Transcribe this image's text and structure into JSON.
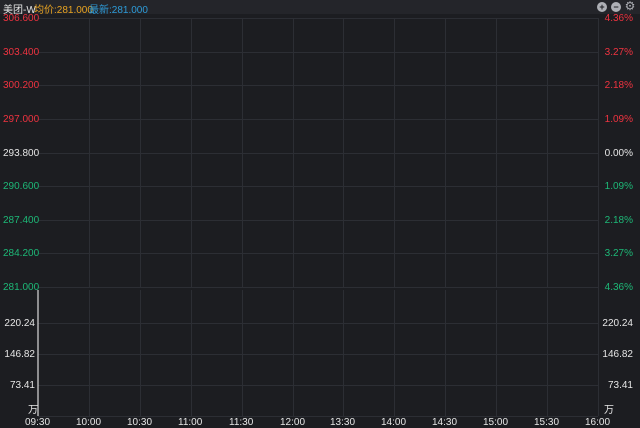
{
  "header": {
    "stock_name": "美团-W",
    "avg_price": "均价:281.000",
    "last_price": "最新:281.000"
  },
  "toolbar": {
    "icons": [
      "plus-circle-icon",
      "minus-circle-icon",
      "gear-icon"
    ]
  },
  "price_axis": {
    "prices": [
      "306.600",
      "303.400",
      "300.200",
      "297.000",
      "293.800",
      "290.600",
      "287.400",
      "284.200",
      "281.000"
    ],
    "percents": [
      "4.36%",
      "3.27%",
      "2.18%",
      "1.09%",
      "0.00%",
      "1.09%",
      "2.18%",
      "3.27%",
      "4.36%"
    ]
  },
  "volume_axis": {
    "values": [
      "220.24",
      "146.82",
      "73.41"
    ],
    "unit": "万"
  },
  "time_axis": [
    "09:30",
    "10:00",
    "10:30",
    "11:00",
    "11:30",
    "12:00",
    "13:30",
    "14:00",
    "14:30",
    "15:00",
    "15:30",
    "16:00"
  ],
  "colors": {
    "up": "#ef3340",
    "down": "#1db877",
    "flat": "#e6e6e6",
    "grid": "#2c2e34",
    "background": "#1c1d21",
    "avg": "#e8a321",
    "last": "#2d9bd8"
  },
  "chart_data": {
    "type": "line",
    "title": "美团-W",
    "x": [
      "09:30",
      "10:00",
      "10:30",
      "11:00",
      "11:30",
      "12:00",
      "13:30",
      "14:00",
      "14:30",
      "15:00",
      "15:30",
      "16:00"
    ],
    "ylim": [
      281.0,
      306.6
    ],
    "series": [],
    "volume_ylim": [
      0,
      220.24
    ],
    "volume_unit": "万",
    "grid": true
  }
}
